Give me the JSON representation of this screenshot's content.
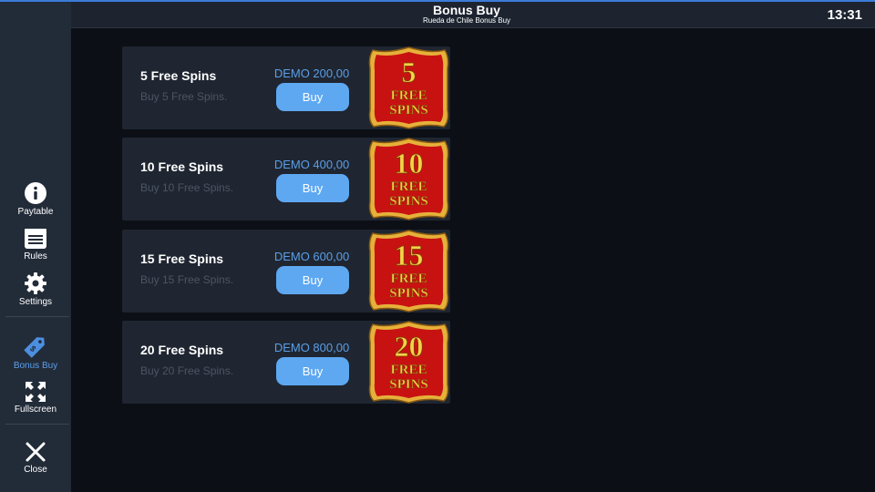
{
  "header": {
    "title": "Bonus Buy",
    "subtitle": "Rueda de Chile Bonus Buy",
    "clock": "13:31"
  },
  "sidebar": {
    "items": [
      {
        "label": "Paytable",
        "icon": "info-icon"
      },
      {
        "label": "Rules",
        "icon": "rules-icon"
      },
      {
        "label": "Settings",
        "icon": "gear-icon"
      },
      {
        "label": "Bonus Buy",
        "icon": "tag-icon",
        "active": true
      },
      {
        "label": "Fullscreen",
        "icon": "fullscreen-icon"
      },
      {
        "label": "Close",
        "icon": "close-icon"
      }
    ]
  },
  "offers": [
    {
      "title": "5 Free Spins",
      "desc": "Buy 5 Free Spins.",
      "price": "DEMO 200,00",
      "button": "Buy",
      "badge_number": "5",
      "badge_line1": "FREE",
      "badge_line2": "SPINS"
    },
    {
      "title": "10 Free Spins",
      "desc": "Buy 10 Free Spins.",
      "price": "DEMO 400,00",
      "button": "Buy",
      "badge_number": "10",
      "badge_line1": "FREE",
      "badge_line2": "SPINS"
    },
    {
      "title": "15 Free Spins",
      "desc": "Buy 15 Free Spins.",
      "price": "DEMO 600,00",
      "button": "Buy",
      "badge_number": "15",
      "badge_line1": "FREE",
      "badge_line2": "SPINS"
    },
    {
      "title": "20 Free Spins",
      "desc": "Buy 20 Free Spins.",
      "price": "DEMO 800,00",
      "button": "Buy",
      "badge_number": "20",
      "badge_line1": "FREE",
      "badge_line2": "SPINS"
    }
  ],
  "colors": {
    "accent": "#5ea8f2",
    "price": "#5a9ee8",
    "badge_red": "#d41414",
    "badge_gold": "#f6d048"
  }
}
